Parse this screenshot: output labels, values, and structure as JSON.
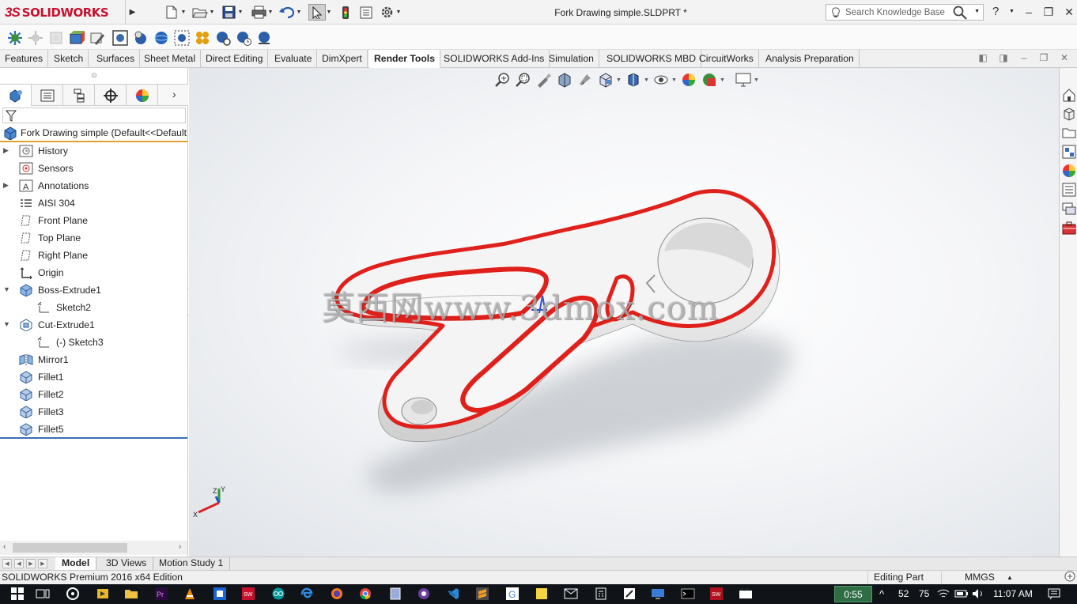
{
  "app": {
    "brand_ds": "3S",
    "brand_name": "SOLIDWORKS",
    "document_title": "Fork Drawing simple.SLDPRT *",
    "search_placeholder": "Search Knowledge Base",
    "help_label": "?"
  },
  "command_tabs": [
    {
      "label": "Features"
    },
    {
      "label": "Sketch"
    },
    {
      "label": "Surfaces"
    },
    {
      "label": "Sheet Metal"
    },
    {
      "label": "Direct Editing"
    },
    {
      "label": "Evaluate"
    },
    {
      "label": "DimXpert"
    },
    {
      "label": "Render Tools",
      "active": true
    },
    {
      "label": "SOLIDWORKS Add-Ins"
    },
    {
      "label": "Simulation"
    },
    {
      "label": "SOLIDWORKS MBD"
    },
    {
      "label": "CircuitWorks"
    },
    {
      "label": "Analysis Preparation"
    }
  ],
  "feature_tree": {
    "root": "Fork Drawing simple  (Default<<Default",
    "items": [
      {
        "label": "History",
        "icon": "history-folder-icon",
        "expandable": true
      },
      {
        "label": "Sensors",
        "icon": "sensors-icon"
      },
      {
        "label": "Annotations",
        "icon": "annotations-icon",
        "expandable": true
      },
      {
        "label": "AISI 304",
        "icon": "material-icon"
      },
      {
        "label": "Front Plane",
        "icon": "plane-icon"
      },
      {
        "label": "Top Plane",
        "icon": "plane-icon"
      },
      {
        "label": "Right Plane",
        "icon": "plane-icon"
      },
      {
        "label": "Origin",
        "icon": "origin-icon"
      },
      {
        "label": "Boss-Extrude1",
        "icon": "boss-extrude-icon",
        "expanded": true
      },
      {
        "label": "Sketch2",
        "icon": "sketch-icon",
        "indent": 1
      },
      {
        "label": "Cut-Extrude1",
        "icon": "cut-extrude-icon",
        "expanded": true
      },
      {
        "label": "(-) Sketch3",
        "icon": "sketch-icon",
        "indent": 1
      },
      {
        "label": "Mirror1",
        "icon": "mirror-icon"
      },
      {
        "label": "Fillet1",
        "icon": "fillet-icon"
      },
      {
        "label": "Fillet2",
        "icon": "fillet-icon"
      },
      {
        "label": "Fillet3",
        "icon": "fillet-icon"
      },
      {
        "label": "Fillet5",
        "icon": "fillet-icon"
      }
    ]
  },
  "viewport": {
    "watermark": "莫西网www.3dmox.com",
    "triad": {
      "x": "X",
      "y": "Y",
      "z": "Z"
    }
  },
  "bottom_tabs": [
    {
      "label": "Model",
      "active": true
    },
    {
      "label": "3D Views"
    },
    {
      "label": "Motion Study 1"
    }
  ],
  "status": {
    "product": "SOLIDWORKS Premium 2016 x64 Edition",
    "mode": "Editing Part",
    "units": "MMGS",
    "units_arrow": "▲"
  },
  "taskbar": {
    "timer": "0:55",
    "tray_a": "52",
    "tray_b": "75",
    "clock": "11:07 AM"
  },
  "colors": {
    "accent_red": "#c8102e",
    "model_face": "#f2f2f2",
    "model_edge": "#e0201a"
  }
}
